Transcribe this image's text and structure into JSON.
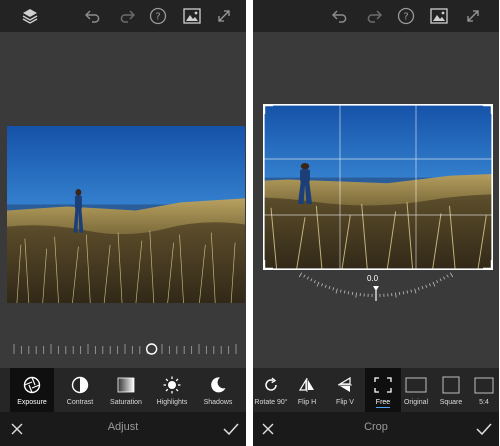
{
  "left_screen": {
    "toolbar": {
      "icons": [
        "layers-icon",
        "undo-icon",
        "redo-icon",
        "help-icon",
        "image-compare-icon",
        "expand-icon"
      ]
    },
    "tools": [
      {
        "label": "Exposure",
        "icon": "exposure-icon",
        "selected": true
      },
      {
        "label": "Contrast",
        "icon": "contrast-icon",
        "selected": false
      },
      {
        "label": "Saturation",
        "icon": "saturation-icon",
        "selected": false
      },
      {
        "label": "Highlights",
        "icon": "highlights-icon",
        "selected": false
      },
      {
        "label": "Shadows",
        "icon": "shadows-icon",
        "selected": false
      }
    ],
    "bottom": {
      "title": "Adjust",
      "cancel_icon": "close-icon",
      "confirm_icon": "check-icon"
    },
    "slider": {
      "value_fraction": 0.62
    }
  },
  "right_screen": {
    "toolbar": {
      "icons": [
        "undo-icon",
        "redo-icon",
        "help-icon",
        "image-compare-icon",
        "expand-icon"
      ]
    },
    "rotation_value": "0.0",
    "tools": [
      {
        "label": "Rotate 90°",
        "icon": "rotate-icon",
        "selected": false
      },
      {
        "label": "Flip H",
        "icon": "flip-horizontal-icon",
        "selected": false
      },
      {
        "label": "Flip V",
        "icon": "flip-vertical-icon",
        "selected": false
      },
      {
        "label": "Free",
        "icon": "free-crop-icon",
        "selected": true
      },
      {
        "label": "Original",
        "icon": "original-ratio-icon",
        "selected": false
      },
      {
        "label": "Square",
        "icon": "square-ratio-icon",
        "selected": false
      },
      {
        "label": "5:4",
        "icon": "ratio-5-4-icon",
        "selected": false
      }
    ],
    "bottom": {
      "title": "Crop",
      "cancel_icon": "close-icon",
      "confirm_icon": "check-icon"
    }
  },
  "colors": {
    "accent": "#4aa3ff",
    "panel_bg": "#3a3a3a",
    "bar_bg": "#232323",
    "sky_top": "#1a5fb4",
    "sky_bottom": "#8fc6e8"
  }
}
